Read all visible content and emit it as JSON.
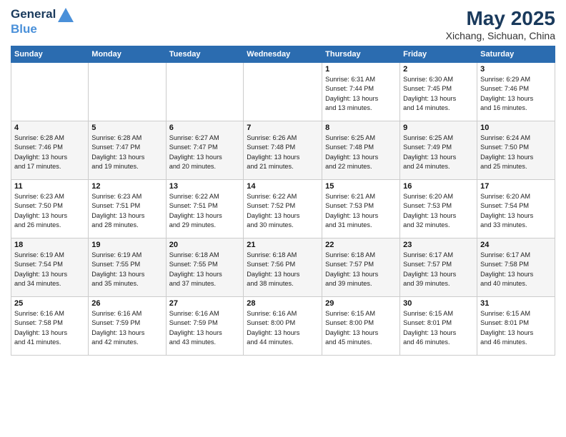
{
  "header": {
    "logo_line1": "General",
    "logo_line2": "Blue",
    "month": "May 2025",
    "location": "Xichang, Sichuan, China"
  },
  "weekdays": [
    "Sunday",
    "Monday",
    "Tuesday",
    "Wednesday",
    "Thursday",
    "Friday",
    "Saturday"
  ],
  "weeks": [
    [
      {
        "day": "",
        "info": ""
      },
      {
        "day": "",
        "info": ""
      },
      {
        "day": "",
        "info": ""
      },
      {
        "day": "",
        "info": ""
      },
      {
        "day": "1",
        "info": "Sunrise: 6:31 AM\nSunset: 7:44 PM\nDaylight: 13 hours\nand 13 minutes."
      },
      {
        "day": "2",
        "info": "Sunrise: 6:30 AM\nSunset: 7:45 PM\nDaylight: 13 hours\nand 14 minutes."
      },
      {
        "day": "3",
        "info": "Sunrise: 6:29 AM\nSunset: 7:46 PM\nDaylight: 13 hours\nand 16 minutes."
      }
    ],
    [
      {
        "day": "4",
        "info": "Sunrise: 6:28 AM\nSunset: 7:46 PM\nDaylight: 13 hours\nand 17 minutes."
      },
      {
        "day": "5",
        "info": "Sunrise: 6:28 AM\nSunset: 7:47 PM\nDaylight: 13 hours\nand 19 minutes."
      },
      {
        "day": "6",
        "info": "Sunrise: 6:27 AM\nSunset: 7:47 PM\nDaylight: 13 hours\nand 20 minutes."
      },
      {
        "day": "7",
        "info": "Sunrise: 6:26 AM\nSunset: 7:48 PM\nDaylight: 13 hours\nand 21 minutes."
      },
      {
        "day": "8",
        "info": "Sunrise: 6:25 AM\nSunset: 7:48 PM\nDaylight: 13 hours\nand 22 minutes."
      },
      {
        "day": "9",
        "info": "Sunrise: 6:25 AM\nSunset: 7:49 PM\nDaylight: 13 hours\nand 24 minutes."
      },
      {
        "day": "10",
        "info": "Sunrise: 6:24 AM\nSunset: 7:50 PM\nDaylight: 13 hours\nand 25 minutes."
      }
    ],
    [
      {
        "day": "11",
        "info": "Sunrise: 6:23 AM\nSunset: 7:50 PM\nDaylight: 13 hours\nand 26 minutes."
      },
      {
        "day": "12",
        "info": "Sunrise: 6:23 AM\nSunset: 7:51 PM\nDaylight: 13 hours\nand 28 minutes."
      },
      {
        "day": "13",
        "info": "Sunrise: 6:22 AM\nSunset: 7:51 PM\nDaylight: 13 hours\nand 29 minutes."
      },
      {
        "day": "14",
        "info": "Sunrise: 6:22 AM\nSunset: 7:52 PM\nDaylight: 13 hours\nand 30 minutes."
      },
      {
        "day": "15",
        "info": "Sunrise: 6:21 AM\nSunset: 7:53 PM\nDaylight: 13 hours\nand 31 minutes."
      },
      {
        "day": "16",
        "info": "Sunrise: 6:20 AM\nSunset: 7:53 PM\nDaylight: 13 hours\nand 32 minutes."
      },
      {
        "day": "17",
        "info": "Sunrise: 6:20 AM\nSunset: 7:54 PM\nDaylight: 13 hours\nand 33 minutes."
      }
    ],
    [
      {
        "day": "18",
        "info": "Sunrise: 6:19 AM\nSunset: 7:54 PM\nDaylight: 13 hours\nand 34 minutes."
      },
      {
        "day": "19",
        "info": "Sunrise: 6:19 AM\nSunset: 7:55 PM\nDaylight: 13 hours\nand 35 minutes."
      },
      {
        "day": "20",
        "info": "Sunrise: 6:18 AM\nSunset: 7:55 PM\nDaylight: 13 hours\nand 37 minutes."
      },
      {
        "day": "21",
        "info": "Sunrise: 6:18 AM\nSunset: 7:56 PM\nDaylight: 13 hours\nand 38 minutes."
      },
      {
        "day": "22",
        "info": "Sunrise: 6:18 AM\nSunset: 7:57 PM\nDaylight: 13 hours\nand 39 minutes."
      },
      {
        "day": "23",
        "info": "Sunrise: 6:17 AM\nSunset: 7:57 PM\nDaylight: 13 hours\nand 39 minutes."
      },
      {
        "day": "24",
        "info": "Sunrise: 6:17 AM\nSunset: 7:58 PM\nDaylight: 13 hours\nand 40 minutes."
      }
    ],
    [
      {
        "day": "25",
        "info": "Sunrise: 6:16 AM\nSunset: 7:58 PM\nDaylight: 13 hours\nand 41 minutes."
      },
      {
        "day": "26",
        "info": "Sunrise: 6:16 AM\nSunset: 7:59 PM\nDaylight: 13 hours\nand 42 minutes."
      },
      {
        "day": "27",
        "info": "Sunrise: 6:16 AM\nSunset: 7:59 PM\nDaylight: 13 hours\nand 43 minutes."
      },
      {
        "day": "28",
        "info": "Sunrise: 6:16 AM\nSunset: 8:00 PM\nDaylight: 13 hours\nand 44 minutes."
      },
      {
        "day": "29",
        "info": "Sunrise: 6:15 AM\nSunset: 8:00 PM\nDaylight: 13 hours\nand 45 minutes."
      },
      {
        "day": "30",
        "info": "Sunrise: 6:15 AM\nSunset: 8:01 PM\nDaylight: 13 hours\nand 46 minutes."
      },
      {
        "day": "31",
        "info": "Sunrise: 6:15 AM\nSunset: 8:01 PM\nDaylight: 13 hours\nand 46 minutes."
      }
    ]
  ]
}
